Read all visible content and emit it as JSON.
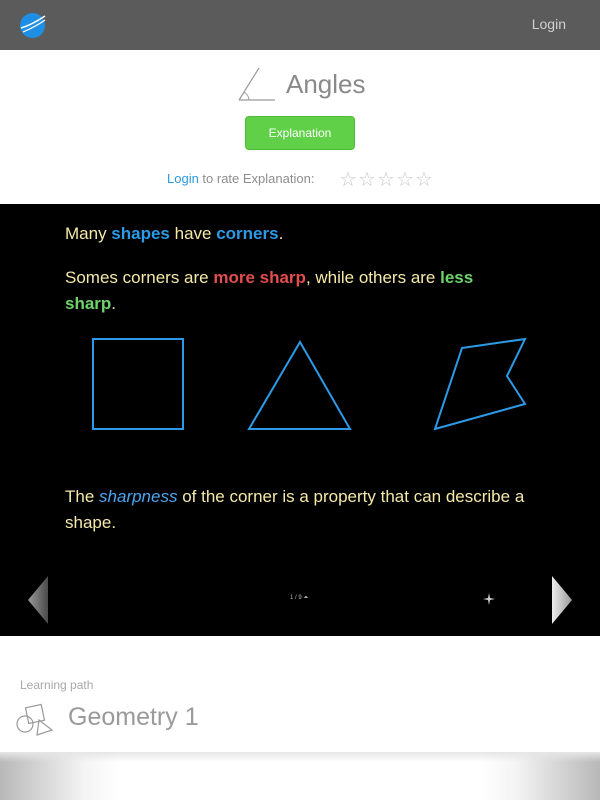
{
  "header": {
    "logo_icon": "planet-logo-icon",
    "login_label": "Login"
  },
  "lesson": {
    "title": "Angles",
    "title_icon": "angle-icon",
    "explanation_button": "Explanation",
    "rate": {
      "login_link": "Login",
      "text": " to rate Explanation:",
      "stars_max": 5,
      "rating": 0
    }
  },
  "slide": {
    "p1": {
      "a": "Many ",
      "b": "shapes",
      "c": " have ",
      "d": "corners",
      "e": "."
    },
    "p2": {
      "a": "Somes corners are ",
      "b": "more sharp",
      "c": ", while others are ",
      "d": "less sharp",
      "e": "."
    },
    "p3": {
      "a": "The ",
      "b": "sharpness",
      "c": " of the corner is a property that can describe a shape."
    },
    "pager": "1 / 9 ⏶",
    "prev_icon": "left-arrow-icon",
    "next_icon": "right-arrow-icon",
    "sparkle_icon": "sparkle-icon"
  },
  "learning_path": {
    "label": "Learning path",
    "title": "Geometry 1",
    "icon": "geometry-shapes-icon"
  },
  "colors": {
    "topbar": "#5b5b5b",
    "button_green": "#5fd048",
    "link_blue": "#2a9ae0",
    "slide_bg": "#000000",
    "slide_text": "#f5e9a8",
    "highlight_blue": "#2d9ae6",
    "highlight_red": "#e24d4d",
    "highlight_green": "#6ed36b"
  }
}
